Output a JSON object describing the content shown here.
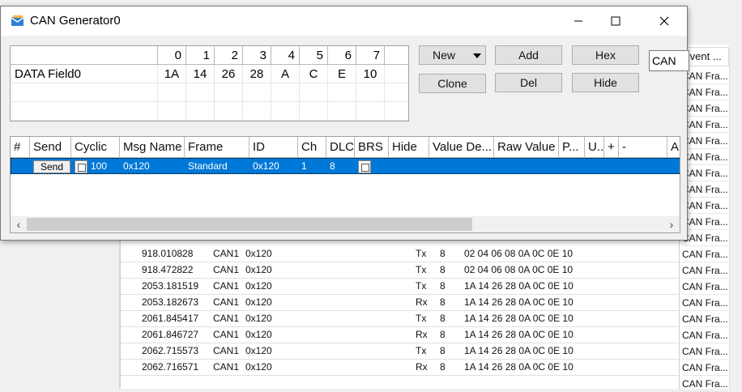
{
  "dialog": {
    "title": "CAN Generator0",
    "window_controls": {
      "minimize": "—",
      "maximize": "☐",
      "close": "✕"
    }
  },
  "data_field": {
    "columns": [
      "0",
      "1",
      "2",
      "3",
      "4",
      "5",
      "6",
      "7"
    ],
    "row_label": "DATA Field0",
    "values": [
      "1A",
      "14",
      "26",
      "28",
      "A",
      "C",
      "E",
      "10"
    ]
  },
  "buttons": {
    "new": "New",
    "add": "Add",
    "hex": "Hex",
    "clone": "Clone",
    "del": "Del",
    "hide": "Hide"
  },
  "protocol_input": {
    "value": "CAN"
  },
  "message_grid": {
    "headers": [
      "#",
      "Send",
      "Cyclic",
      "Msg Name",
      "Frame",
      "ID",
      "Ch",
      "DLC",
      "BRS",
      "Hide",
      "Value De...",
      "Raw Value",
      "P...",
      "U..",
      "+",
      "-",
      "A"
    ],
    "row": {
      "send_label": "Send",
      "cyclic": "100",
      "msg_name": "0x120",
      "frame": "Standard",
      "id": "0x120",
      "ch": "1",
      "dlc": "8"
    }
  },
  "trace": {
    "right_header": "Event ...",
    "right_column": [
      "CAN Fra...",
      "CAN Fra...",
      "CAN Fra...",
      "CAN Fra...",
      "CAN Fra...",
      "CAN Fra...",
      "CAN Fra...",
      "CAN Fra...",
      "CAN Fra...",
      "CAN Fra...",
      "CAN Fra...",
      "CAN Fra...",
      "CAN Fra...",
      "CAN Fra...",
      "CAN Fra...",
      "CAN Fra...",
      "CAN Fra...",
      "CAN Fra...",
      "CAN Fra...",
      "CAN Fra..."
    ],
    "rows": [
      {
        "time": "918.010828",
        "ch": "CAN1",
        "id": "0x120",
        "dir": "Tx",
        "dlc": "8",
        "data": "02  04  06  08  0A  0C  0E  10"
      },
      {
        "time": "918.472822",
        "ch": "CAN1",
        "id": "0x120",
        "dir": "Tx",
        "dlc": "8",
        "data": "02  04  06  08  0A  0C  0E  10"
      },
      {
        "time": "2053.181519",
        "ch": "CAN1",
        "id": "0x120",
        "dir": "Tx",
        "dlc": "8",
        "data": "1A  14  26  28  0A  0C  0E  10"
      },
      {
        "time": "2053.182673",
        "ch": "CAN1",
        "id": "0x120",
        "dir": "Rx",
        "dlc": "8",
        "data": "1A  14  26  28  0A  0C  0E  10"
      },
      {
        "time": "2061.845417",
        "ch": "CAN1",
        "id": "0x120",
        "dir": "Tx",
        "dlc": "8",
        "data": "1A  14  26  28  0A  0C  0E  10"
      },
      {
        "time": "2061.846727",
        "ch": "CAN1",
        "id": "0x120",
        "dir": "Rx",
        "dlc": "8",
        "data": "1A  14  26  28  0A  0C  0E  10"
      },
      {
        "time": "2062.715573",
        "ch": "CAN1",
        "id": "0x120",
        "dir": "Tx",
        "dlc": "8",
        "data": "1A  14  26  28  0A  0C  0E  10"
      },
      {
        "time": "2062.716571",
        "ch": "CAN1",
        "id": "0x120",
        "dir": "Rx",
        "dlc": "8",
        "data": "1A  14  26  28  0A  0C  0E  10"
      }
    ]
  },
  "colors": {
    "selection": "#0078d7",
    "window_bg": "#f0f0f0"
  }
}
